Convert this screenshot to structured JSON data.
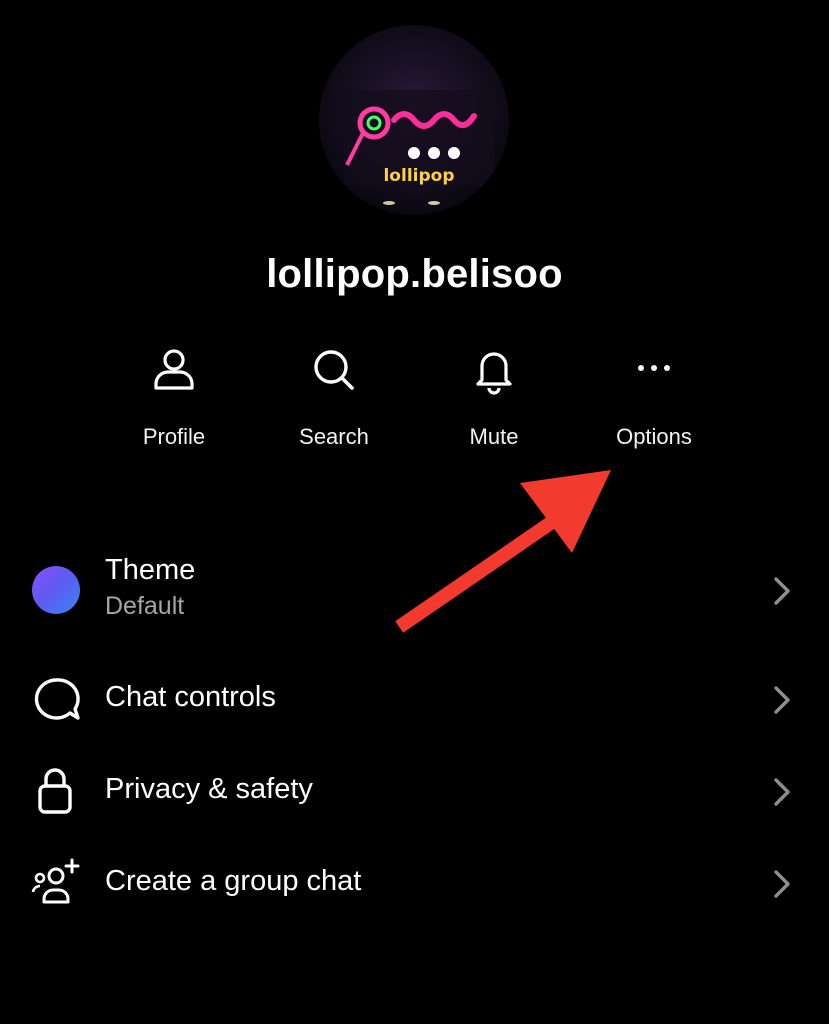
{
  "profile": {
    "username": "lollipop.belisoo",
    "avatar_text": "lollipop",
    "avatar_script": "بلیسو"
  },
  "actions": [
    {
      "label": "Profile",
      "icon": "person-icon"
    },
    {
      "label": "Search",
      "icon": "search-icon"
    },
    {
      "label": "Mute",
      "icon": "bell-icon"
    },
    {
      "label": "Options",
      "icon": "more-horizontal-icon"
    }
  ],
  "menu": {
    "theme": {
      "title": "Theme",
      "subtitle": "Default",
      "icon": "theme-gradient-dot"
    },
    "chat_controls": {
      "title": "Chat controls",
      "icon": "chat-bubble-icon"
    },
    "privacy": {
      "title": "Privacy & safety",
      "icon": "lock-icon"
    },
    "group_chat": {
      "title": "Create a group chat",
      "icon": "add-people-icon"
    }
  },
  "colors": {
    "background": "#000000",
    "text": "#ffffff",
    "subtext": "#a6a6a6",
    "chevron": "#8e8e8e",
    "annotation_arrow": "#f23a2f"
  }
}
